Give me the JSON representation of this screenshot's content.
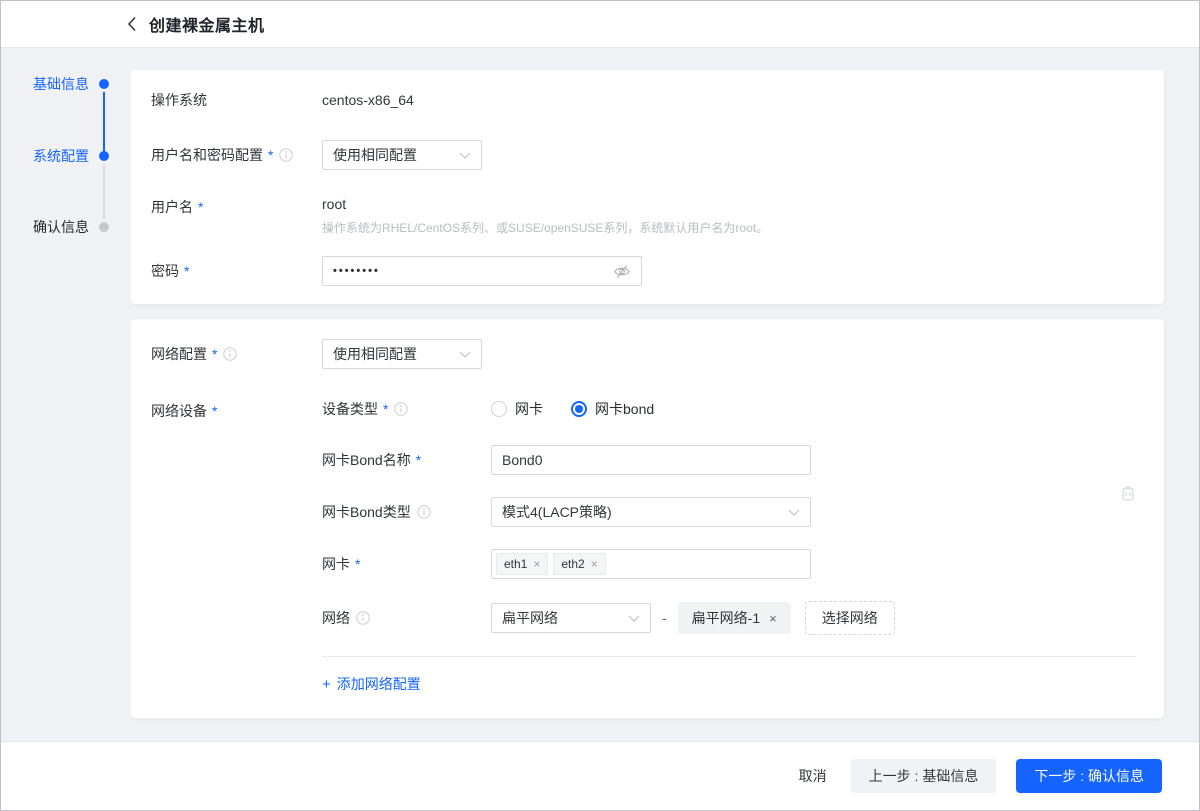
{
  "header": {
    "title": "创建裸金属主机"
  },
  "steps": [
    {
      "label": "基础信息",
      "state": "done"
    },
    {
      "label": "系统配置",
      "state": "active"
    },
    {
      "label": "确认信息",
      "state": "pending"
    }
  ],
  "ui": {
    "required_mark": "*",
    "dash": "-",
    "plus": "+"
  },
  "system_card": {
    "os_label": "操作系统",
    "os_value": "centos-x86_64",
    "user_pass_label": "用户名和密码配置",
    "user_pass_value": "使用相同配置",
    "username_label": "用户名",
    "username_value": "root",
    "username_hint": "操作系统为RHEL/CentOS系列、或SUSE/openSUSE系列，系统默认用户名为root。",
    "password_label": "密码",
    "password_value": "••••••••"
  },
  "network_card": {
    "config_label": "网络配置",
    "config_value": "使用相同配置",
    "device_label": "网络设备",
    "device_type_label": "设备类型",
    "radio_nic_label": "网卡",
    "radio_bond_label": "网卡bond",
    "bond_name_label": "网卡Bond名称",
    "bond_name_value": "Bond0",
    "bond_type_label": "网卡Bond类型",
    "bond_type_value": "模式4(LACP策略)",
    "nic_label": "网卡",
    "nic_tags": [
      "eth1",
      "eth2"
    ],
    "tag_remove_glyph": "×",
    "network_label": "网络",
    "network_type_value": "扁平网络",
    "network_tag_value": "扁平网络-1",
    "select_network_button": "选择网络",
    "add_config_link": "添加网络配置"
  },
  "footer": {
    "cancel_label": "取消",
    "prev_label": "上一步 : 基础信息",
    "next_label": "下一步 : 确认信息"
  },
  "colors": {
    "primary": "#1664ff",
    "page_bg": "#f0f2f5",
    "pending_dot": "#c6c9cf"
  }
}
